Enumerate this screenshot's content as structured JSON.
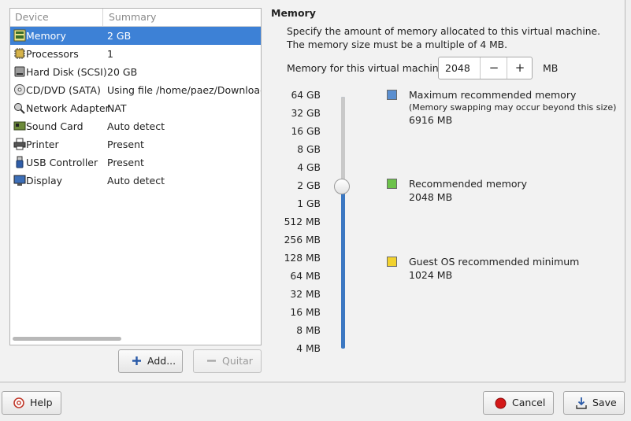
{
  "device_list": {
    "columns": {
      "device": "Device",
      "summary": "Summary"
    },
    "rows": [
      {
        "device": "Memory",
        "summary": "2 GB",
        "icon": "memory-icon",
        "selected": true
      },
      {
        "device": "Processors",
        "summary": "1",
        "icon": "processor-icon"
      },
      {
        "device": "Hard Disk (SCSI)",
        "summary": "20 GB",
        "icon": "hard-disk-icon"
      },
      {
        "device": "CD/DVD (SATA)",
        "summary": "Using file /home/paez/Downloads/’",
        "icon": "cd-dvd-icon"
      },
      {
        "device": "Network Adapter",
        "summary": "NAT",
        "icon": "network-adapter-icon"
      },
      {
        "device": "Sound Card",
        "summary": "Auto detect",
        "icon": "sound-card-icon"
      },
      {
        "device": "Printer",
        "summary": "Present",
        "icon": "printer-icon"
      },
      {
        "device": "USB Controller",
        "summary": "Present",
        "icon": "usb-controller-icon"
      },
      {
        "device": "Display",
        "summary": "Auto detect",
        "icon": "display-icon"
      }
    ],
    "add_label": "Add...",
    "remove_label": "Quitar"
  },
  "memory": {
    "title": "Memory",
    "description": "Specify the amount of memory allocated to this virtual machine. The memory size must be a multiple of 4 MB.",
    "field_label": "Memory for this virtual machine:",
    "value": "2048",
    "minus": "−",
    "plus": "+",
    "unit": "MB",
    "slider_ticks": [
      "64 GB",
      "32 GB",
      "16 GB",
      "8 GB",
      "4 GB",
      "2 GB",
      "1 GB",
      "512 MB",
      "256 MB",
      "128 MB",
      "64 MB",
      "32 MB",
      "16 MB",
      "8 MB",
      "4 MB"
    ],
    "slider_selected": "2 GB",
    "legend": {
      "max": {
        "title": "Maximum recommended memory",
        "note": "(Memory swapping may occur beyond this size)",
        "value": "6916 MB",
        "color": "#5b8fd0"
      },
      "recommended": {
        "title": "Recommended memory",
        "value": "2048 MB",
        "color": "#6cc24a"
      },
      "minimum": {
        "title": "Guest OS recommended minimum",
        "value": "1024 MB",
        "color": "#f2d22e"
      }
    }
  },
  "footer": {
    "help_label": "Help",
    "cancel_label": "Cancel",
    "save_label": "Save"
  }
}
